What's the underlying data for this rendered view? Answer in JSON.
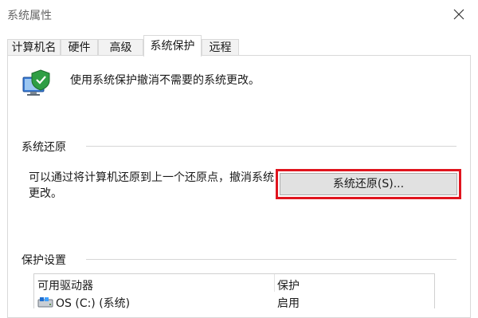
{
  "window": {
    "title": "系统属性"
  },
  "tabs": [
    {
      "label": "计算机名"
    },
    {
      "label": "硬件"
    },
    {
      "label": "高级"
    },
    {
      "label": "系统保护",
      "active": true
    },
    {
      "label": "远程"
    }
  ],
  "intro": {
    "text": "使用系统保护撤消不需要的系统更改。",
    "icon": "system-protection-icon"
  },
  "system_restore": {
    "heading": "系统还原",
    "description": "可以通过将计算机还原到上一个还原点，撤消系统更改。",
    "button_label": "系统还原(S)..."
  },
  "protection_settings": {
    "heading": "保护设置",
    "columns": [
      "可用驱动器",
      "保护"
    ],
    "rows": [
      {
        "drive": "OS (C:) (系统)",
        "protection": "启用",
        "icon": "drive-icon"
      }
    ]
  },
  "colors": {
    "highlight": "#e0141e",
    "button_bg": "#e1e1e1"
  }
}
